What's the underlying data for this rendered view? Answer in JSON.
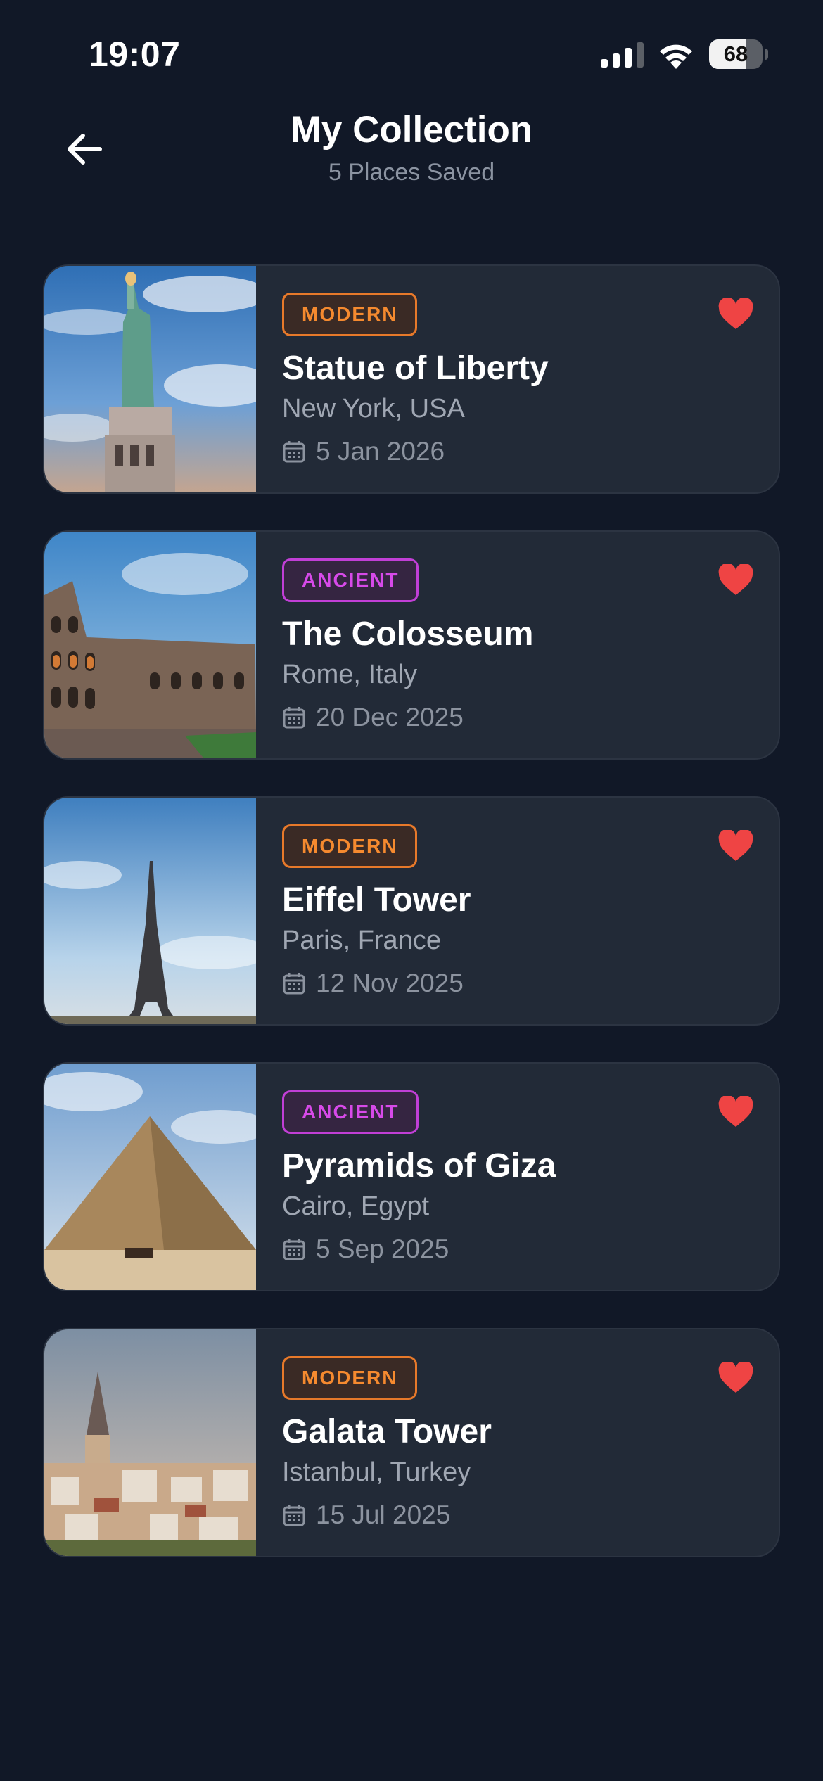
{
  "status": {
    "time": "19:07",
    "battery": "68",
    "battery_level": 0.68
  },
  "header": {
    "title": "My Collection",
    "subtitle": "5 Places Saved",
    "back_icon": "arrow-left-icon"
  },
  "icons": {
    "date": "calendar-icon",
    "favorite": "heart-icon"
  },
  "colors": {
    "background": "#111827",
    "card": "#222a37",
    "modern": "#f58a2f",
    "ancient": "#d74ae9",
    "heart": "#ef4444"
  },
  "places": [
    {
      "category": "MODERN",
      "name": "Statue of Liberty",
      "location": "New York, USA",
      "date": "5 Jan 2026",
      "favorited": true
    },
    {
      "category": "ANCIENT",
      "name": "The Colosseum",
      "location": "Rome, Italy",
      "date": "20 Dec 2025",
      "favorited": true
    },
    {
      "category": "MODERN",
      "name": "Eiffel Tower",
      "location": "Paris, France",
      "date": "12 Nov 2025",
      "favorited": true
    },
    {
      "category": "ANCIENT",
      "name": "Pyramids of Giza",
      "location": "Cairo, Egypt",
      "date": "5 Sep 2025",
      "favorited": true
    },
    {
      "category": "MODERN",
      "name": "Galata Tower",
      "location": "Istanbul, Turkey",
      "date": "15 Jul 2025",
      "favorited": true
    }
  ]
}
